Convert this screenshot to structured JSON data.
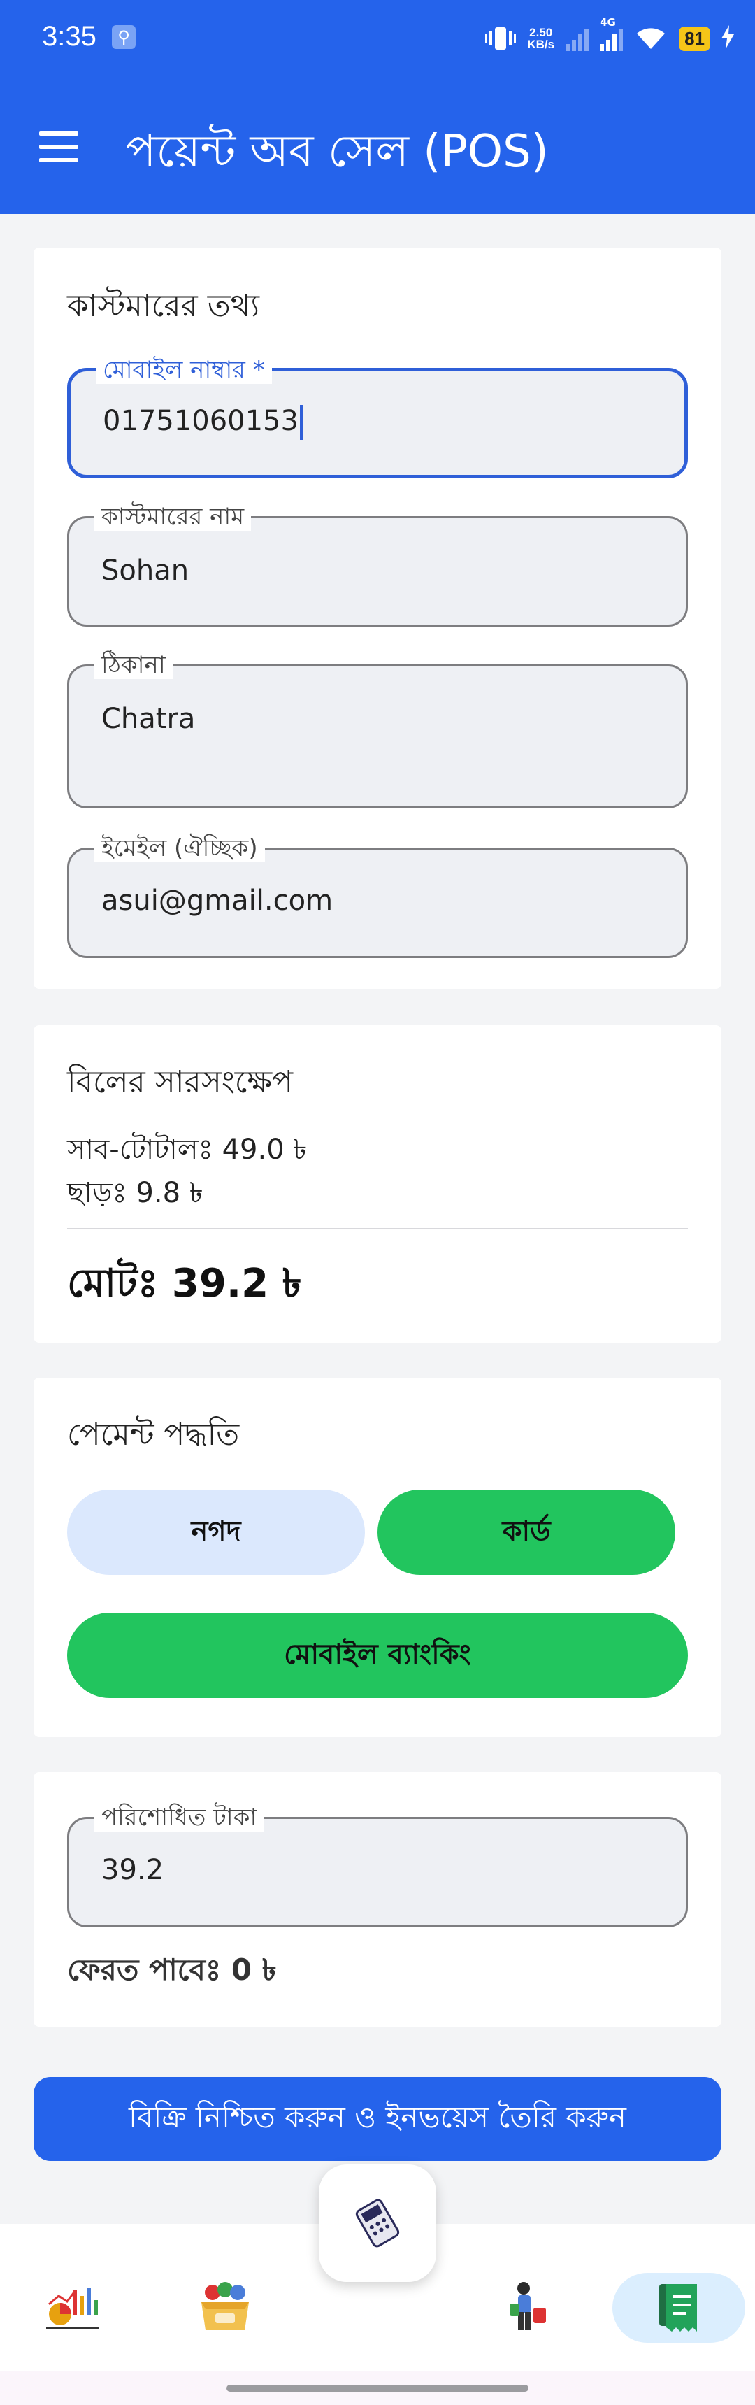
{
  "status_bar": {
    "time": "3:35",
    "net_speed_value": "2.50",
    "net_speed_unit": "KB/s",
    "network_type": "4G",
    "battery": "81"
  },
  "app_bar": {
    "title": "পয়েন্ট অব সেল (POS)"
  },
  "customer": {
    "title": "কাস্টমারের তথ্য",
    "mobile_label": "মোবাইল নাম্বার *",
    "mobile_value": "01751060153",
    "name_label": "কাস্টমারের নাম",
    "name_value": "Sohan",
    "address_label": "ঠিকানা",
    "address_value": "Chatra",
    "email_label": "ইমেইল (ঐচ্ছিক)",
    "email_value": "asui@gmail.com"
  },
  "summary": {
    "title": "বিলের সারসংক্ষেপ",
    "subtotal": "সাব-টোটালঃ 49.0 ৳",
    "discount": "ছাড়ঃ 9.8 ৳",
    "total": "মোটঃ 39.2 ৳"
  },
  "payment": {
    "title": "পেমেন্ট পদ্ধতি",
    "cash_label": "নগদ",
    "card_label": "কার্ড",
    "mobile_banking_label": "মোবাইল ব্যাংকিং"
  },
  "paid": {
    "label": "পরিশোধিত টাকা",
    "value": "39.2",
    "change": "ফেরত পাবেঃ 0 ৳"
  },
  "confirm_button": "বিক্রি নিশ্চিত করুন ও ইনভয়েস তৈরি করুন",
  "colors": {
    "primary": "#2563eb",
    "green": "#22c55e",
    "light_blue": "#dbe8fd"
  }
}
